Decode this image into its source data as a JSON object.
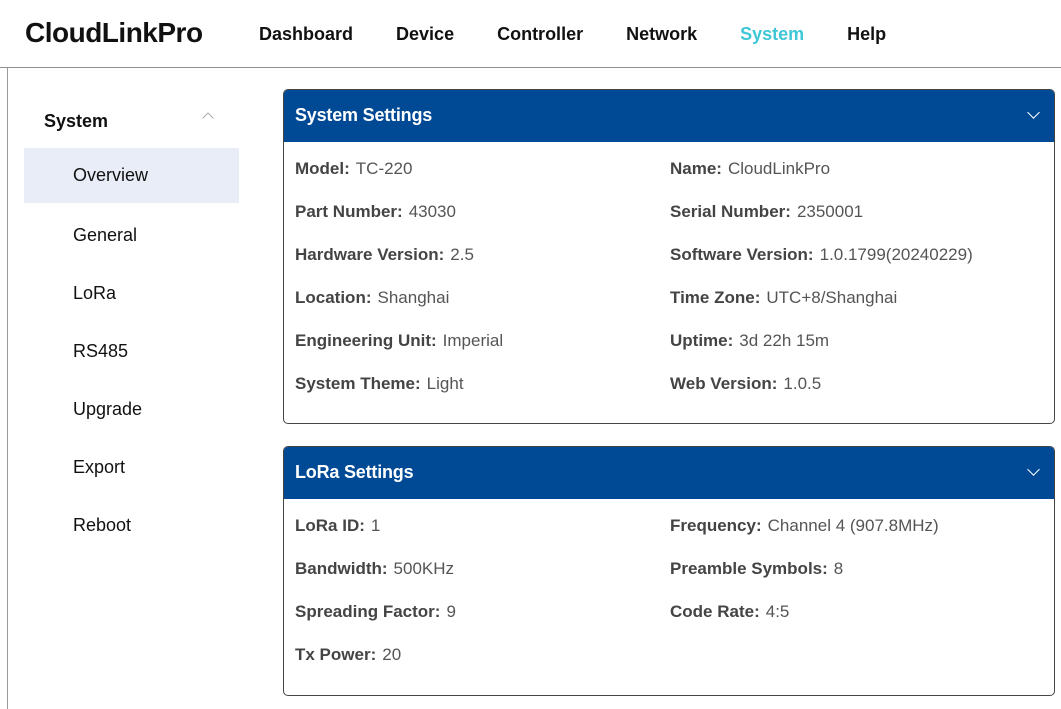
{
  "app": {
    "brand": "CloudLinkPro"
  },
  "nav": [
    {
      "label": "Dashboard",
      "active": false
    },
    {
      "label": "Device",
      "active": false
    },
    {
      "label": "Controller",
      "active": false
    },
    {
      "label": "Network",
      "active": false
    },
    {
      "label": "System",
      "active": true
    },
    {
      "label": "Help",
      "active": false
    }
  ],
  "sidebar": {
    "title": "System",
    "items": [
      {
        "label": "Overview",
        "active": true
      },
      {
        "label": "General"
      },
      {
        "label": "LoRa"
      },
      {
        "label": "RS485"
      },
      {
        "label": "Upgrade"
      },
      {
        "label": "Export"
      },
      {
        "label": "Reboot"
      }
    ]
  },
  "colors": {
    "header_blue": "#004a95",
    "accent": "#3ec7d6",
    "active_bg": "#e8edf8"
  },
  "system_settings": {
    "title": "System Settings",
    "left": [
      {
        "key": "Model:",
        "value": "TC-220"
      },
      {
        "key": "Part Number:",
        "value": "43030"
      },
      {
        "key": "Hardware Version:",
        "value": "2.5"
      },
      {
        "key": "Location:",
        "value": "Shanghai"
      },
      {
        "key": "Engineering Unit:",
        "value": "Imperial"
      },
      {
        "key": "System Theme:",
        "value": "Light"
      }
    ],
    "right": [
      {
        "key": "Name:",
        "value": "CloudLinkPro"
      },
      {
        "key": "Serial Number:",
        "value": "2350001"
      },
      {
        "key": "Software Version:",
        "value": "1.0.1799(20240229)"
      },
      {
        "key": "Time Zone:",
        "value": "UTC+8/Shanghai"
      },
      {
        "key": "Uptime:",
        "value": "3d 22h 15m"
      },
      {
        "key": "Web Version:",
        "value": "1.0.5"
      }
    ]
  },
  "lora_settings": {
    "title": "LoRa Settings",
    "left": [
      {
        "key": "LoRa ID:",
        "value": "1"
      },
      {
        "key": "Bandwidth:",
        "value": "500KHz"
      },
      {
        "key": "Spreading Factor:",
        "value": "9"
      },
      {
        "key": "Tx Power:",
        "value": "20"
      }
    ],
    "right": [
      {
        "key": "Frequency:",
        "value": "Channel 4 (907.8MHz)"
      },
      {
        "key": "Preamble Symbols:",
        "value": "8"
      },
      {
        "key": "Code Rate:",
        "value": "4:5"
      }
    ]
  }
}
